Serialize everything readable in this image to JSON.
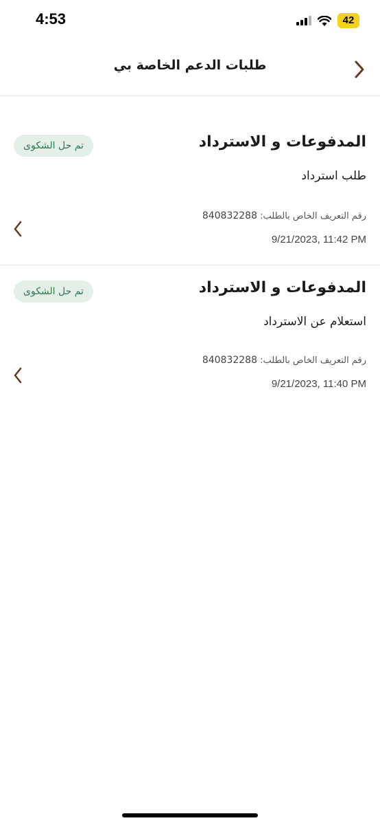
{
  "status_bar": {
    "time": "4:53",
    "battery": "42"
  },
  "header": {
    "title": "طلبات الدعم الخاصة بي",
    "back_icon": "chevron-right-icon"
  },
  "requests": [
    {
      "category": "المدفوعات و الاسترداد",
      "status": "تم حل الشكوى",
      "subject": "طلب استرداد",
      "id_label": "رقم التعريف الخاص بالطلب:",
      "id_value": "840832288",
      "datetime": "9/21/2023, 11:42 PM"
    },
    {
      "category": "المدفوعات و الاسترداد",
      "status": "تم حل الشكوى",
      "subject": "استعلام عن الاسترداد",
      "id_label": "رقم التعريف الخاص بالطلب:",
      "id_value": "840832288",
      "datetime": "9/21/2023, 11:40 PM"
    }
  ],
  "colors": {
    "accent": "#6b3a1e",
    "status_bg": "#e3efe7",
    "status_text": "#2e7d4f",
    "battery": "#f5d21e"
  }
}
